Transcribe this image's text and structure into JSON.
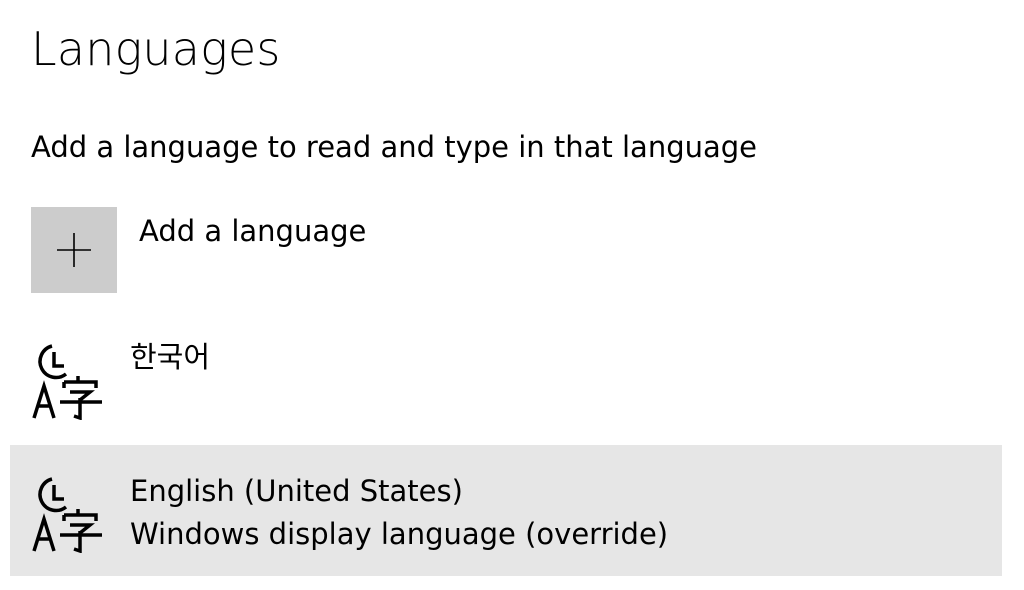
{
  "header": {
    "title": "Languages",
    "description": "Add a language to read and type in that language"
  },
  "add_language": {
    "label": "Add a language",
    "icon": "plus-icon"
  },
  "languages": [
    {
      "name": "한국어",
      "subtitle": "",
      "icon": "language-icon",
      "selected": false
    },
    {
      "name": "English (United States)",
      "subtitle": "Windows display language (override)",
      "icon": "language-icon",
      "selected": true
    }
  ],
  "colors": {
    "add_button_bg": "#cccccc",
    "selected_row_bg": "#e6e6e6",
    "text": "#000000"
  }
}
